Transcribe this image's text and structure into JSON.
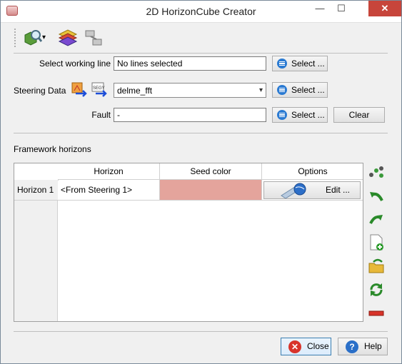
{
  "window": {
    "title": "2D HorizonCube Creator",
    "minimize": "—",
    "maximize": "☐",
    "close": "✕"
  },
  "toolbar": {
    "icons": [
      "inspect-icon",
      "horizons-icon",
      "transfer-icon"
    ],
    "dropdown": "▾"
  },
  "form": {
    "working_line": {
      "label": "Select working line",
      "value": "No lines selected",
      "button": "Select ..."
    },
    "steering": {
      "label": "Steering Data",
      "value": "delme_fft",
      "arrow": "▾",
      "button": "Select ..."
    },
    "fault": {
      "label": "Fault",
      "value": "-",
      "button": "Select ...",
      "clear": "Clear"
    }
  },
  "framework": {
    "title": "Framework horizons",
    "columns": [
      "Horizon",
      "Seed color",
      "Options"
    ],
    "rows": [
      {
        "label": "Horizon 1",
        "horizon": "<From Steering 1>",
        "seed_color": "#e4a49c",
        "edit": "Edit ..."
      }
    ]
  },
  "side_buttons": [
    "add-points-icon",
    "undo-icon",
    "redo-icon",
    "new-file-icon",
    "open-folder-icon",
    "refresh-icon",
    "remove-icon"
  ],
  "footer": {
    "close": "Close",
    "help": "Help"
  }
}
